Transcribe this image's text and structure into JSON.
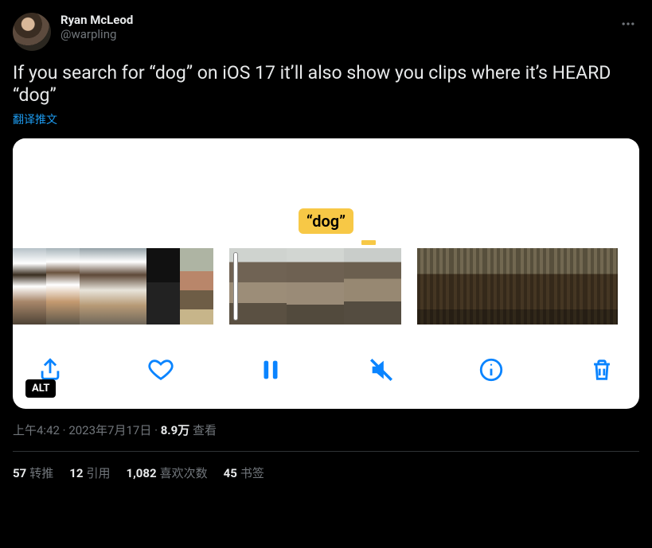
{
  "author": {
    "name": "Ryan McLeod",
    "handle": "@warpling"
  },
  "body": "If you search for “dog” on iOS 17 it’ll also show you clips where it’s HEARD “dog”",
  "translate_label": "翻译推文",
  "media": {
    "caption_bubble": "“dog”",
    "alt_badge": "ALT",
    "toolbar_icons": [
      "share",
      "heart",
      "pause",
      "mute",
      "info",
      "trash"
    ]
  },
  "meta": {
    "time": "上午4:42",
    "date": "2023年7月17日",
    "views_count": "8.9万",
    "views_label": "查看"
  },
  "stats": {
    "retweets_count": "57",
    "retweets_label": "转推",
    "quotes_count": "12",
    "quotes_label": "引用",
    "likes_count": "1,082",
    "likes_label": "喜欢次数",
    "bookmarks_count": "45",
    "bookmarks_label": "书签"
  }
}
